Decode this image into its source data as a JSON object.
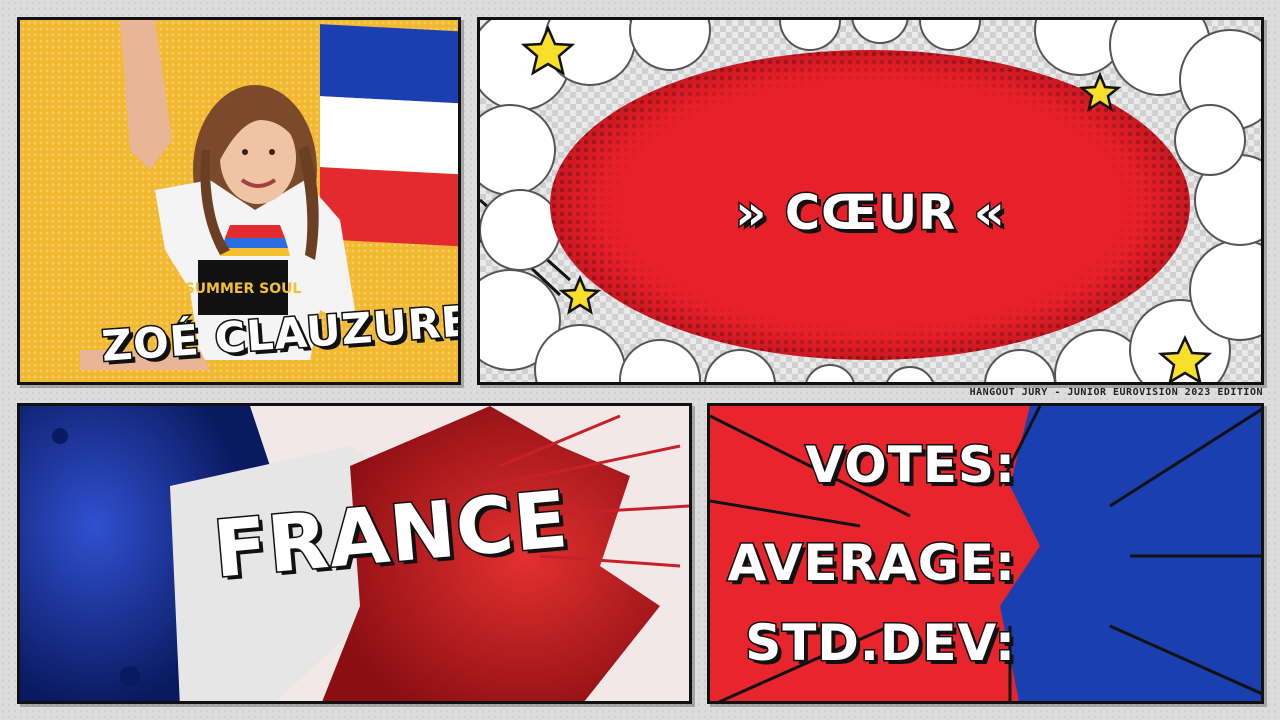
{
  "artist": {
    "name": "ZOÉ CLAUZURE",
    "shirt_text": "SUMMER SOUL"
  },
  "song": {
    "title": "» CŒUR «"
  },
  "country": {
    "name": "FRANCE"
  },
  "stats": {
    "votes_label": "VOTES:",
    "average_label": "AVERAGE:",
    "stddev_label": "STD.DEV:"
  },
  "footer": {
    "caption": "HANGOUT JURY - JUNIOR EUROVISION 2023 EDITION"
  },
  "colors": {
    "flag_blue": "#1b3fb3",
    "flag_white": "#ffffff",
    "flag_red": "#e32b2f",
    "panel_yellow": "#f2b930",
    "burst_red": "#e8202a",
    "stats_blue": "#1a3fb0",
    "stats_red": "#e8252d"
  }
}
